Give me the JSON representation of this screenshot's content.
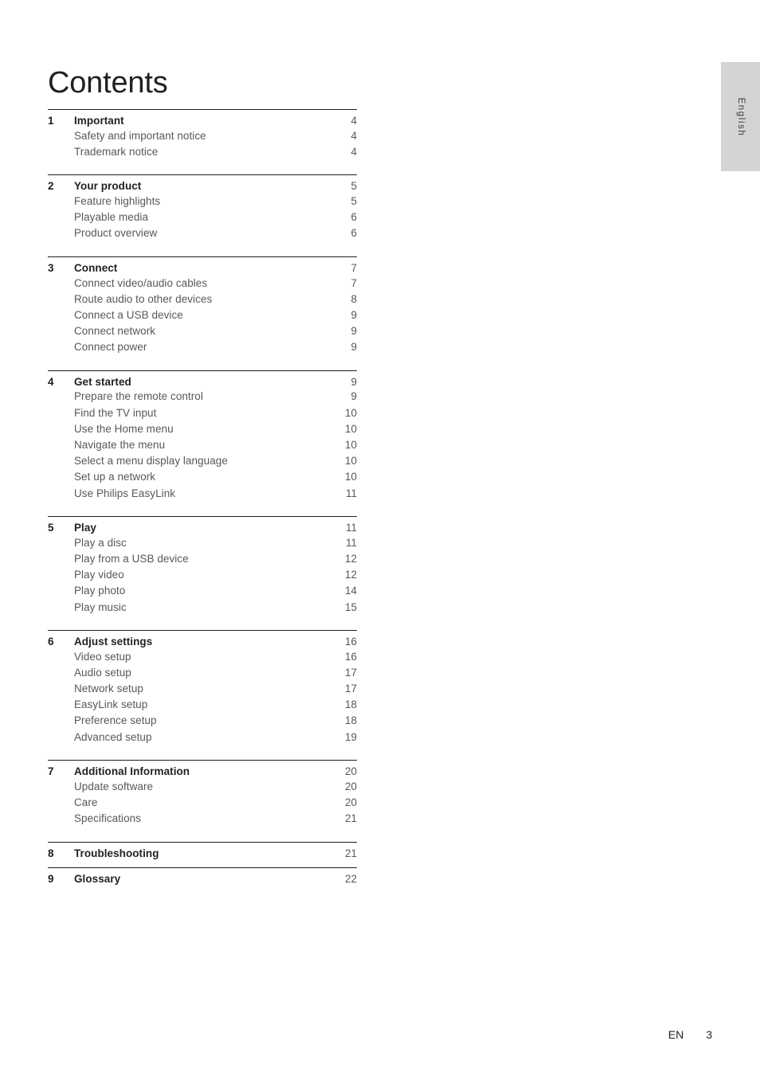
{
  "page_title": "Contents",
  "side_tab": {
    "label": "English"
  },
  "footer": {
    "locale": "EN",
    "page_number": "3"
  },
  "colors": {
    "heading_text": "#231f20",
    "item_text": "#58585b",
    "rule": "#231f20",
    "tab_background": "#d3d4d6"
  },
  "toc": {
    "sections": [
      {
        "number": "1",
        "title": "Important",
        "page": "4",
        "items": [
          {
            "label": "Safety and important notice",
            "page": "4"
          },
          {
            "label": "Trademark notice",
            "page": "4"
          }
        ]
      },
      {
        "number": "2",
        "title": "Your product",
        "page": "5",
        "items": [
          {
            "label": "Feature highlights",
            "page": "5"
          },
          {
            "label": "Playable media",
            "page": "6"
          },
          {
            "label": "Product overview",
            "page": "6"
          }
        ]
      },
      {
        "number": "3",
        "title": "Connect",
        "page": "7",
        "items": [
          {
            "label": "Connect video/audio cables",
            "page": "7"
          },
          {
            "label": "Route audio to other devices",
            "page": "8"
          },
          {
            "label": "Connect a USB device",
            "page": "9"
          },
          {
            "label": "Connect network",
            "page": "9"
          },
          {
            "label": "Connect power",
            "page": "9"
          }
        ]
      },
      {
        "number": "4",
        "title": "Get started",
        "page": "9",
        "items": [
          {
            "label": "Prepare the remote control",
            "page": "9"
          },
          {
            "label": "Find the TV input",
            "page": "10"
          },
          {
            "label": "Use the Home menu",
            "page": "10"
          },
          {
            "label": "Navigate the menu",
            "page": "10"
          },
          {
            "label": "Select a menu display language",
            "page": "10"
          },
          {
            "label": "Set up a network",
            "page": "10"
          },
          {
            "label": "Use Philips EasyLink",
            "page": "11"
          }
        ]
      },
      {
        "number": "5",
        "title": "Play",
        "page": "11",
        "items": [
          {
            "label": "Play a disc",
            "page": "11"
          },
          {
            "label": "Play from a USB device",
            "page": "12"
          },
          {
            "label": "Play video",
            "page": "12"
          },
          {
            "label": "Play photo",
            "page": "14"
          },
          {
            "label": "Play music",
            "page": "15"
          }
        ]
      },
      {
        "number": "6",
        "title": "Adjust settings",
        "page": "16",
        "items": [
          {
            "label": "Video setup",
            "page": "16"
          },
          {
            "label": "Audio setup",
            "page": "17"
          },
          {
            "label": "Network setup",
            "page": "17"
          },
          {
            "label": "EasyLink setup",
            "page": "18"
          },
          {
            "label": "Preference setup",
            "page": "18"
          },
          {
            "label": "Advanced setup",
            "page": "19"
          }
        ]
      },
      {
        "number": "7",
        "title": "Additional Information",
        "page": "20",
        "items": [
          {
            "label": "Update software",
            "page": "20"
          },
          {
            "label": "Care",
            "page": "20"
          },
          {
            "label": "Specifications",
            "page": "21"
          }
        ]
      },
      {
        "number": "8",
        "title": "Troubleshooting",
        "page": "21",
        "items": []
      },
      {
        "number": "9",
        "title": "Glossary",
        "page": "22",
        "items": []
      }
    ]
  }
}
